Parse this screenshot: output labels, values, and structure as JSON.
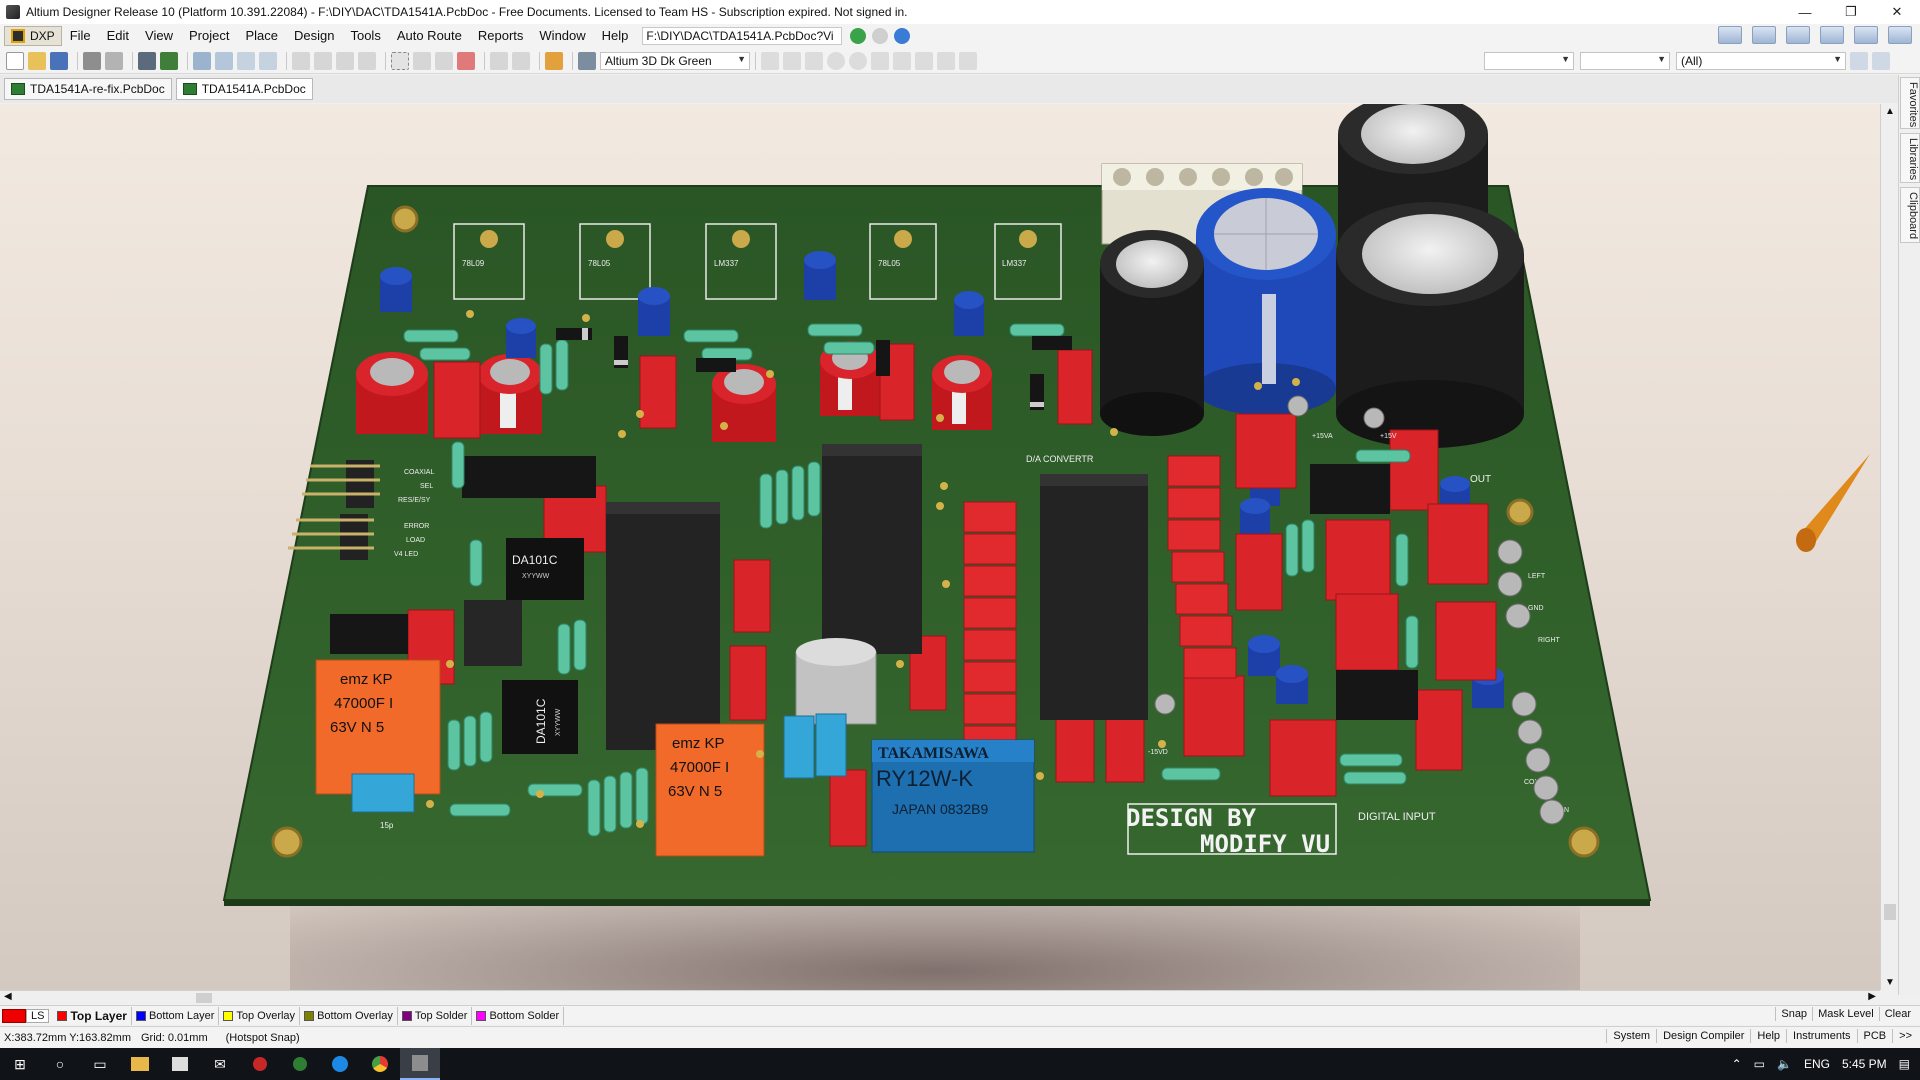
{
  "window": {
    "title": "Altium Designer Release 10 (Platform 10.391.22084) - F:\\DIY\\DAC\\TDA1541A.PcbDoc - Free Documents. Licensed to Team HS - Subscription expired. Not signed in.",
    "controls": [
      "—",
      "❐",
      "✕"
    ]
  },
  "menu": {
    "dxp": "DXP",
    "items": [
      "File",
      "Edit",
      "View",
      "Project",
      "Place",
      "Design",
      "Tools",
      "Auto Route",
      "Reports",
      "Window",
      "Help"
    ],
    "path": "F:\\DIY\\DAC\\TDA1541A.PcbDoc?Vi"
  },
  "toolbar": {
    "view_config": "Altium 3D Dk Green",
    "filter_all": "(All)"
  },
  "tabs": [
    {
      "label": "TDA1541A-re-fix.PcbDoc"
    },
    {
      "label": "TDA1541A.PcbDoc"
    }
  ],
  "side_panels": [
    "Favorites",
    "Libraries",
    "Clipboard"
  ],
  "board": {
    "colors": {
      "pcb": "#2f5d2a",
      "resistor": "#61c5a4",
      "red_cap": "#d9242a",
      "ic": "#222222"
    },
    "regulators": [
      "78L09",
      "78L05",
      "LM337",
      "78L05",
      "LM337"
    ],
    "ic_labels": [
      "DA101C",
      "DA101C"
    ],
    "ic_sublabels": [
      "XYYWW",
      "XYYWW"
    ],
    "cap1": {
      "l1": "emz  KP",
      "l2": "47000F I",
      "l3": "63V N 5"
    },
    "cap2": {
      "l1": "emz  KP",
      "l2": "47000F I",
      "l3": "63V N 5"
    },
    "relay": {
      "brand": "TAKAMISAWA",
      "model": "RY12W-K",
      "origin": "JAPAN 0832B9"
    },
    "silk_da": "D/A CONVERTR",
    "silk_out": "OUT",
    "silk_digital": "DIGITAL INPUT",
    "silk_design": "DESIGN BY",
    "silk_modify": "MODIFY VU",
    "header_labels": [
      "COAXIAL",
      "SEL",
      "RES/E/SY",
      "ERROR",
      "LOAD",
      "V4 LED"
    ],
    "right_labels": [
      "LEFT",
      "GND",
      "RIGHT",
      "COX",
      "IN"
    ],
    "small_labels": [
      "+15VA",
      "+15V",
      "15p",
      "-15VD"
    ]
  },
  "layers": {
    "ls": "LS",
    "list": [
      {
        "name": "Top Layer",
        "color": "#ff0000"
      },
      {
        "name": "Bottom Layer",
        "color": "#0000ff"
      },
      {
        "name": "Top Overlay",
        "color": "#ffff00"
      },
      {
        "name": "Bottom Overlay",
        "color": "#808000"
      },
      {
        "name": "Top Solder",
        "color": "#800080"
      },
      {
        "name": "Bottom Solder",
        "color": "#ff00ff"
      }
    ],
    "right": [
      "Snap",
      "Mask Level",
      "Clear"
    ]
  },
  "status": {
    "coords": "X:383.72mm Y:163.82mm",
    "grid": "Grid: 0.01mm",
    "snap": "(Hotspot Snap)",
    "buttons": [
      "System",
      "Design Compiler",
      "Help",
      "Instruments",
      "PCB",
      ">>"
    ]
  },
  "taskbar": {
    "lang": "ENG",
    "time": "5:45 PM"
  }
}
